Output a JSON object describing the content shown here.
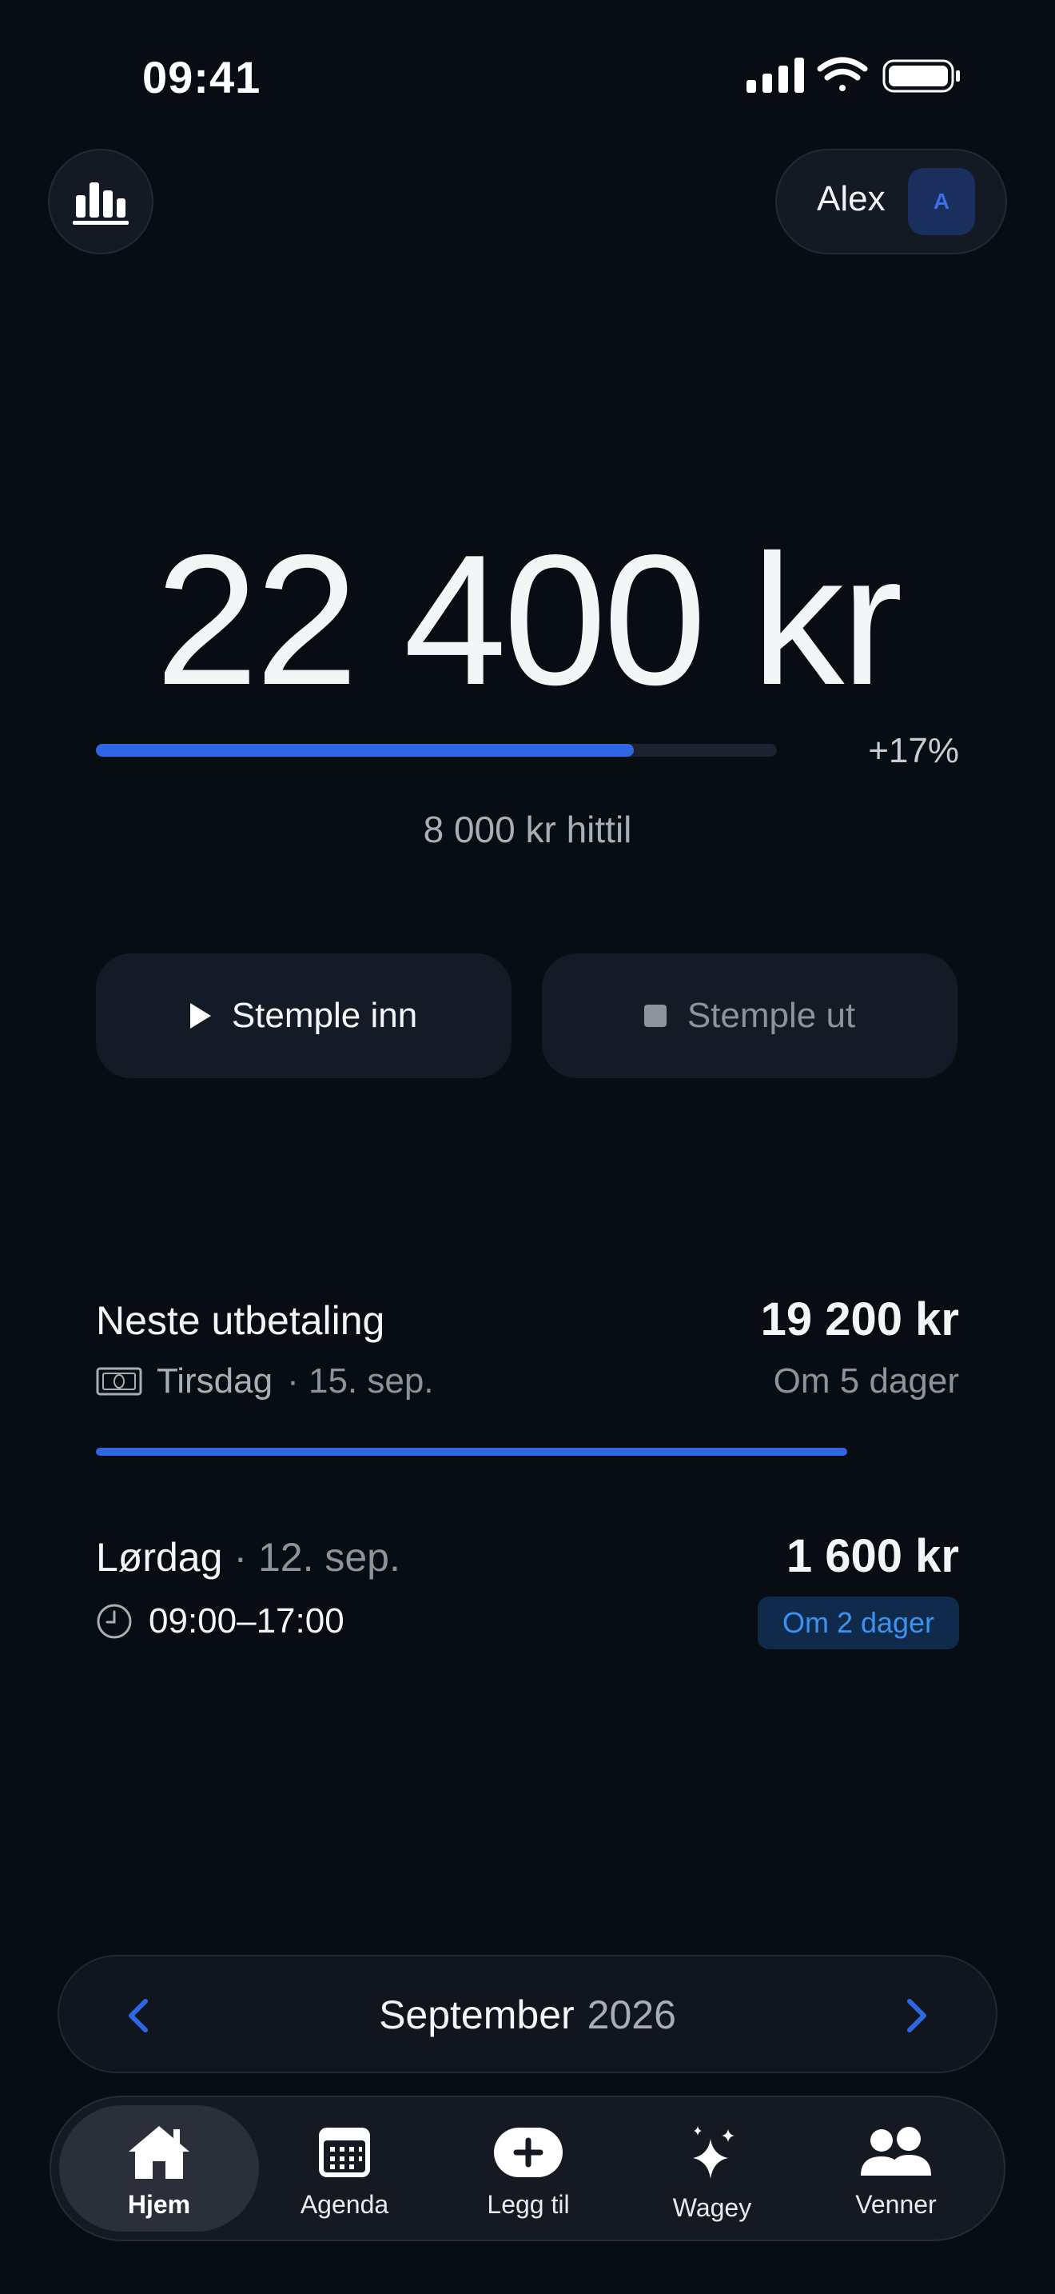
{
  "status_bar": {
    "time": "09:41"
  },
  "header": {
    "profile_name": "Alex",
    "avatar_initial": "A"
  },
  "earnings": {
    "total": "22 400 kr",
    "progress_fraction": 0.79,
    "change_label": "+17%",
    "so_far_label": "8 000 kr hittil"
  },
  "actions": {
    "clock_in": "Stemple inn",
    "clock_out": "Stemple ut"
  },
  "next_payment": {
    "title": "Neste utbetaling",
    "amount": "19 200 kr",
    "day": "Tirsdag",
    "date": "· 15. sep.",
    "countdown": "Om 5 dager",
    "progress_fraction": 0.87
  },
  "shift": {
    "day": "Lørdag",
    "date": "· 12. sep.",
    "time": "09:00–17:00",
    "amount": "1 600 kr",
    "countdown": "Om 2 dager"
  },
  "month_selector": {
    "month": "September",
    "year": "2026"
  },
  "tabs": [
    {
      "label": "Hjem",
      "icon": "home-icon",
      "active": true
    },
    {
      "label": "Agenda",
      "icon": "calendar-icon",
      "active": false
    },
    {
      "label": "Legg til",
      "icon": "plus-icon",
      "active": false
    },
    {
      "label": "Wagey",
      "icon": "sparkles-icon",
      "active": false
    },
    {
      "label": "Venner",
      "icon": "people-icon",
      "active": false
    }
  ],
  "colors": {
    "background": "#080c13",
    "accent": "#2f66e3",
    "badge_text": "#3b93f0"
  }
}
